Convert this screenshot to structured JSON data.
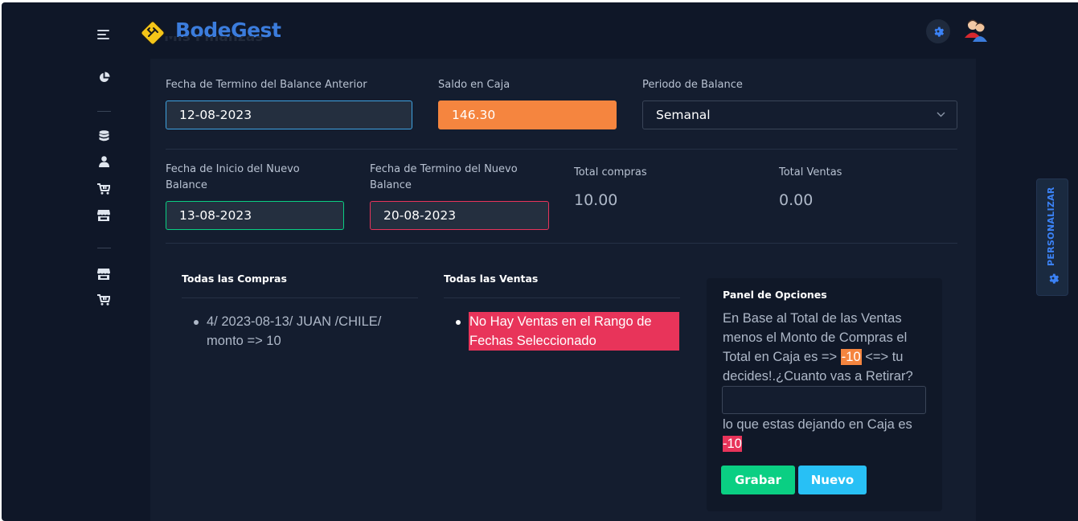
{
  "header": {
    "app_name": "BodeGest",
    "ghost_title": "Mis Finanzas"
  },
  "sidebar": {
    "icons": [
      "chart-pie-icon",
      "database-icon",
      "user-icon",
      "cart-icon",
      "store-icon",
      "store-icon",
      "cart-icon"
    ]
  },
  "balance": {
    "prev_end_label": "Fecha de Termino del Balance Anterior",
    "prev_end_value": "12-08-2023",
    "cash_label": "Saldo en Caja",
    "cash_value": "146.30",
    "period_label": "Periodo de Balance",
    "period_value": "Semanal",
    "new_start_label": "Fecha de Inicio del Nuevo Balance",
    "new_start_value": "13-08-2023",
    "new_end_label": "Fecha de Termino del Nuevo Balance",
    "new_end_value": "20-08-2023",
    "total_purchases_label": "Total compras",
    "total_purchases_value": "10.00",
    "total_sales_label": "Total Ventas",
    "total_sales_value": "0.00"
  },
  "purchases": {
    "title": "Todas las Compras",
    "items": [
      "4/ 2023-08-13/ JUAN /CHILE/ monto => 10"
    ]
  },
  "sales": {
    "title": "Todas las Ventas",
    "items": [
      "No Hay Ventas en el Rango de Fechas Seleccionado"
    ]
  },
  "options_panel": {
    "title": "Panel de Opciones",
    "text_line1": "En Base al Total de las Ventas",
    "text_line2": "menos el Monto de Compras el",
    "text_line3_pre": "Total en Caja es =>",
    "text_line3_value": "-10",
    "text_line3_post": "<=> tu",
    "text_line4": "decides!.¿Cuanto vas a Retirar?",
    "withdraw_value": "",
    "remaining_text": "lo que estas dejando en Caja es",
    "remaining_value": "-10",
    "save_label": "Grabar",
    "new_label": "Nuevo"
  },
  "customize": {
    "label": "PERSONALIZAR"
  },
  "colors": {
    "background": "#0f1728",
    "card": "#141d2f",
    "brand": "#3b7cdc",
    "orange": "#f5853f",
    "red": "#e8345a",
    "green": "#0acf83",
    "cyan": "#28c0f5"
  }
}
